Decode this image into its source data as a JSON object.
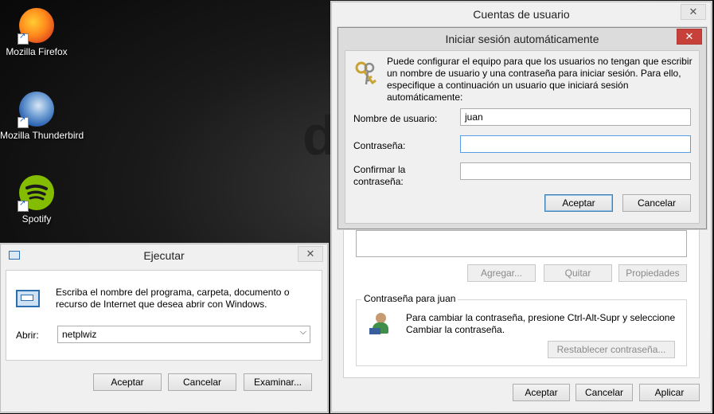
{
  "desktop": {
    "wallpaper_letter": "d",
    "icons": [
      {
        "name": "Mozilla Firefox",
        "icon": "firefox-icon"
      },
      {
        "name": "Mozilla Thunderbird",
        "icon": "thunderbird-icon"
      },
      {
        "name": "Spotify",
        "icon": "spotify-icon"
      }
    ]
  },
  "run_dialog": {
    "title": "Ejecutar",
    "close": "✕",
    "description": "Escriba el nombre del programa, carpeta, documento o recurso de Internet que desea abrir con Windows.",
    "open_label": "Abrir:",
    "open_value": "netplwiz",
    "buttons": {
      "ok": "Aceptar",
      "cancel": "Cancelar",
      "browse": "Examinar..."
    }
  },
  "user_accounts": {
    "title": "Cuentas de usuario",
    "close": "✕",
    "list_buttons": {
      "add": "Agregar...",
      "remove": "Quitar",
      "properties": "Propiedades"
    },
    "password_group": {
      "legend": "Contraseña para juan",
      "text": "Para cambiar la contraseña, presione Ctrl-Alt-Supr y seleccione Cambiar la contraseña.",
      "reset_button": "Restablecer contraseña..."
    },
    "buttons": {
      "ok": "Aceptar",
      "cancel": "Cancelar",
      "apply": "Aplicar"
    }
  },
  "autologon_dialog": {
    "title": "Iniciar sesión automáticamente",
    "close": "✕",
    "description": "Puede configurar el equipo para que los usuarios no tengan que escribir un nombre de usuario y una contraseña para iniciar sesión. Para ello, especifique a continuación un usuario que iniciará sesión automáticamente:",
    "username_label": "Nombre de usuario:",
    "username_value": "juan",
    "password_label": "Contraseña:",
    "password_value": "",
    "confirm_label": "Confirmar la contraseña:",
    "confirm_value": "",
    "buttons": {
      "ok": "Aceptar",
      "cancel": "Cancelar"
    }
  },
  "colors": {
    "accent_close": "#c7403a",
    "focus_border": "#569de5"
  }
}
